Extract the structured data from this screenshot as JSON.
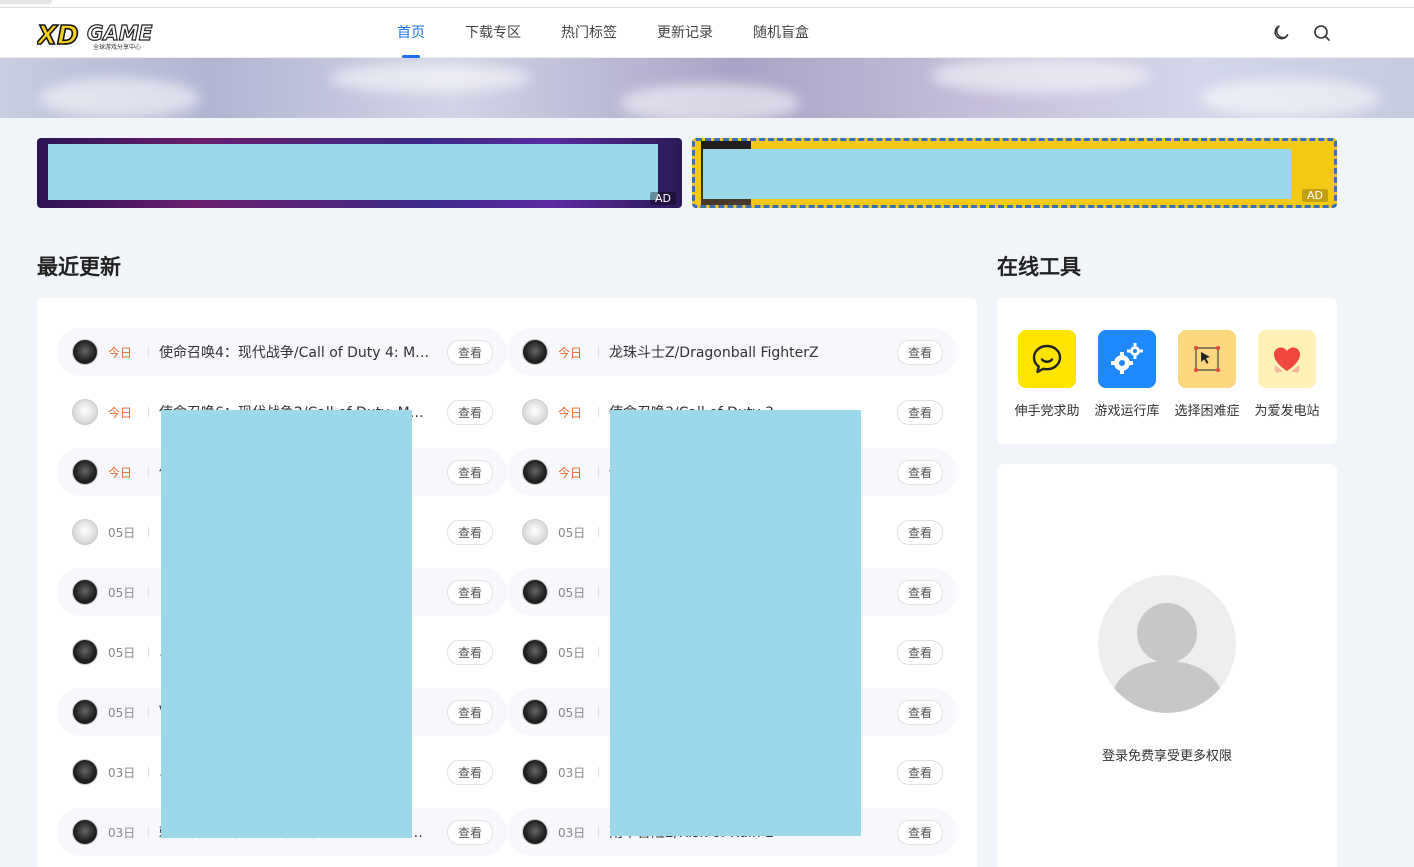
{
  "header": {
    "logo_text": "XDGAME",
    "logo_sub": "全球游戏分享中心",
    "nav": [
      {
        "label": "首页",
        "active": true
      },
      {
        "label": "下载专区",
        "active": false
      },
      {
        "label": "热门标签",
        "active": false
      },
      {
        "label": "更新记录",
        "active": false
      },
      {
        "label": "随机盲盒",
        "active": false
      }
    ],
    "icons": [
      "moon-icon",
      "search-icon"
    ]
  },
  "ads": [
    {
      "tag": "AD"
    },
    {
      "tag": "AD"
    }
  ],
  "recent": {
    "heading": "最近更新",
    "view_label": "查看",
    "left": [
      {
        "date": "今日",
        "title": "使命召唤4：现代战争/Call of Duty 4: M…",
        "today": true
      },
      {
        "date": "今日",
        "title": "使命召唤6：现代战争2/Call of Duty: M…",
        "today": true
      },
      {
        "date": "今日",
        "title": "使",
        "today": true
      },
      {
        "date": "05日",
        "title": "",
        "today": false
      },
      {
        "date": "05日",
        "title": "",
        "today": false
      },
      {
        "date": "05日",
        "title": "…",
        "today": false
      },
      {
        "date": "05日",
        "title": "V",
        "today": false
      },
      {
        "date": "03日",
        "title": "…",
        "today": false
      },
      {
        "date": "03日",
        "title": "刺客信条编年史：俄罗斯/Assassin's Cr…",
        "today": false
      }
    ],
    "right": [
      {
        "date": "今日",
        "title": "龙珠斗士Z/Dragonball FighterZ",
        "today": true
      },
      {
        "date": "今日",
        "title": "使命召唤3/Call of Duty 3",
        "today": true
      },
      {
        "date": "今日",
        "title": "使",
        "today": true
      },
      {
        "date": "05日",
        "title": "",
        "today": false
      },
      {
        "date": "05日",
        "title": "",
        "today": false
      },
      {
        "date": "05日",
        "title": "",
        "today": false
      },
      {
        "date": "05日",
        "title": "…",
        "today": false
      },
      {
        "date": "03日",
        "title": "…",
        "today": false
      },
      {
        "date": "03日",
        "title": "雨中冒险2/Risk of Rain 2",
        "today": false
      }
    ]
  },
  "tools": {
    "heading": "在线工具",
    "items": [
      {
        "label": "伸手党求助",
        "color": "#ffe400",
        "icon": "chat-bubble-icon"
      },
      {
        "label": "游戏运行库",
        "color": "#1e88ff",
        "icon": "gears-icon"
      },
      {
        "label": "选择困难症",
        "color": "#fdd77e",
        "icon": "cursor-select-icon"
      },
      {
        "label": "为爱发电站",
        "color": "#fff1b8",
        "icon": "heart-icon"
      }
    ]
  },
  "login": {
    "text": "登录免费享受更多权限"
  }
}
